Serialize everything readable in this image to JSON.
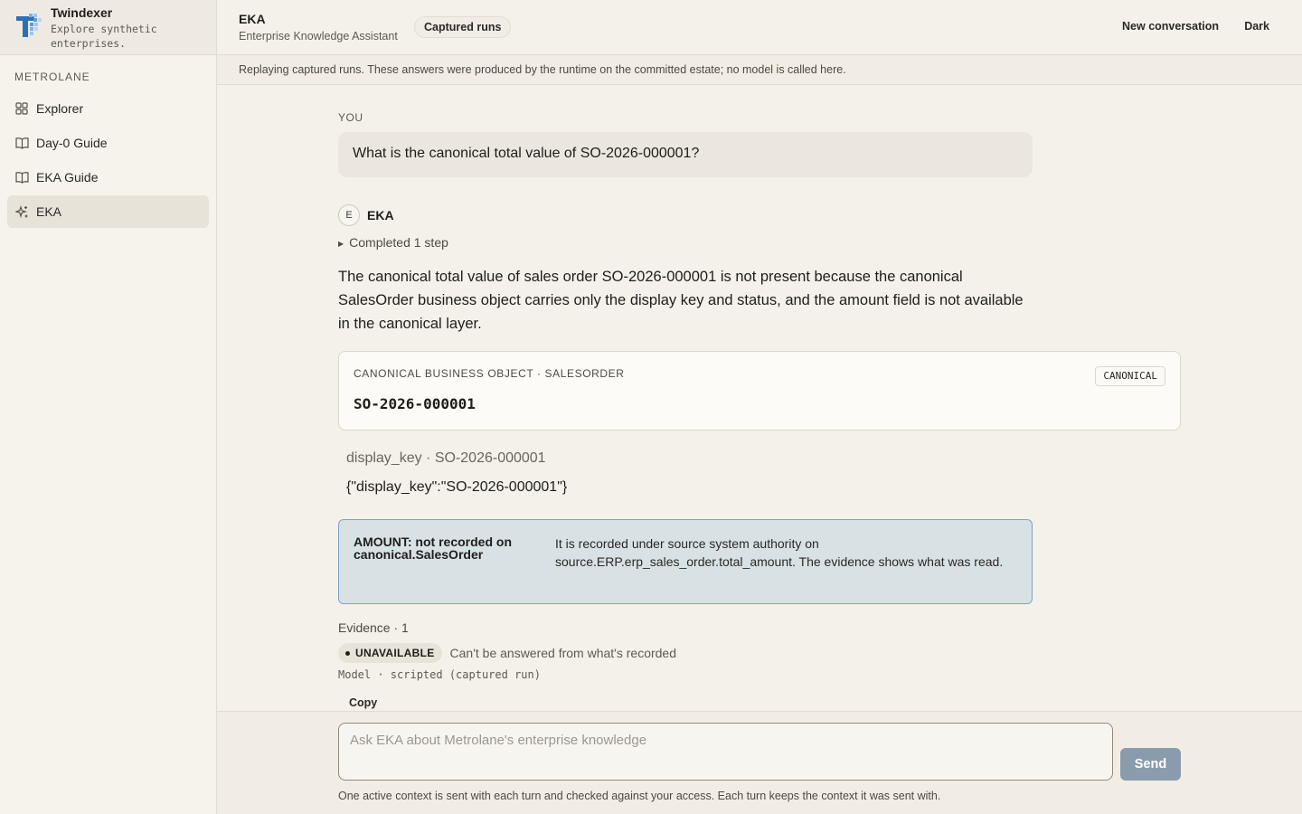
{
  "brand": {
    "name": "Twindexer",
    "tagline": "Explore synthetic enterprises."
  },
  "sidebar": {
    "org": "METROLANE",
    "items": [
      {
        "label": "Explorer",
        "icon": "grid-icon"
      },
      {
        "label": "Day-0 Guide",
        "icon": "book-icon"
      },
      {
        "label": "EKA Guide",
        "icon": "book-icon"
      },
      {
        "label": "EKA",
        "icon": "sparkle-icon",
        "active": true
      }
    ]
  },
  "header": {
    "title": "EKA",
    "subtitle": "Enterprise Knowledge Assistant",
    "badge": "Captured runs",
    "new_conversation": "New conversation",
    "theme_toggle": "Dark"
  },
  "banner": "Replaying captured runs. These answers were produced by the runtime on the committed estate; no model is called here.",
  "conversation": {
    "user_label": "YOU",
    "user_message": "What is the canonical total value of SO-2026-000001?",
    "assistant_avatar": "E",
    "assistant_name": "EKA",
    "steps": "Completed 1 step",
    "answer": "The canonical total value of sales order SO-2026-000001 is not present because the canonical SalesOrder business object carries only the display key and status, and the amount field is not available in the canonical layer.",
    "card": {
      "label": "CANONICAL BUSINESS OBJECT · SALESORDER",
      "badge": "CANONICAL",
      "value": "SO-2026-000001"
    },
    "field": {
      "key": "display_key · SO-2026-000001",
      "json": "{\"display_key\":\"SO-2026-000001\"}"
    },
    "notice": {
      "title": "AMOUNT: not recorded on canonical.SalesOrder",
      "body": "It is recorded under source system authority on source.ERP.erp_sales_order.total_amount. The evidence shows what was read."
    },
    "evidence": {
      "label": "Evidence · 1",
      "status": "UNAVAILABLE",
      "status_desc": "Can't be answered from what's recorded"
    },
    "model": "Model · scripted (captured run)",
    "copy": "Copy"
  },
  "composer": {
    "placeholder": "Ask EKA about Metrolane's enterprise knowledge",
    "send": "Send",
    "note": "One active context is sent with each turn and checked against your access. Each turn keeps the context it was sent with."
  },
  "colors": {
    "accent_notice_bg": "#d8e1e4",
    "accent_notice_border": "#7fa3c4",
    "send_button": "#8b9bae",
    "logo_blue": "#2f6fb5"
  }
}
